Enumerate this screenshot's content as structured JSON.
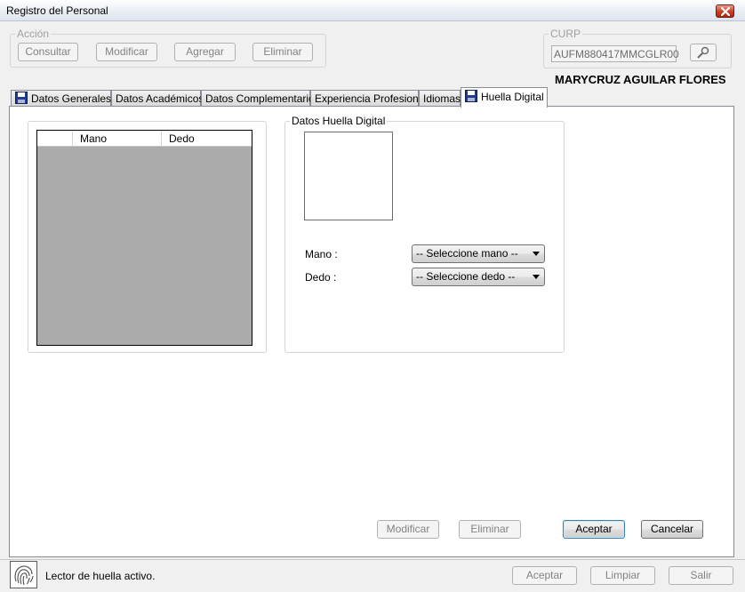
{
  "window": {
    "title": "Registro del Personal"
  },
  "accion": {
    "legend": "Acción",
    "buttons": [
      "Consultar",
      "Modificar",
      "Agregar",
      "Eliminar"
    ]
  },
  "curp": {
    "legend": "CURP",
    "value": "AUFM880417MMCGLR00"
  },
  "person": {
    "full_name": "MARYCRUZ AGUILAR FLORES"
  },
  "tabs": [
    {
      "label": "Datos Generales",
      "icon": "floppy-disk-icon"
    },
    {
      "label": "Datos Académicos"
    },
    {
      "label": "Datos Complementarios"
    },
    {
      "label": "Experiencia Profesional"
    },
    {
      "label": "Idiomas"
    },
    {
      "label": "Huella Digital",
      "icon": "floppy-disk-icon",
      "active": true
    }
  ],
  "grid": {
    "columns": [
      "",
      "Mano",
      "Dedo"
    ]
  },
  "huella": {
    "legend": "Datos Huella Digital",
    "mano_label": "Mano :",
    "dedo_label": "Dedo :",
    "mano_selected": "-- Seleccione mano --",
    "dedo_selected": "-- Seleccione dedo --"
  },
  "panel_buttons": {
    "modificar": "Modificar",
    "eliminar": "Eliminar",
    "aceptar": "Aceptar",
    "cancelar": "Cancelar"
  },
  "status": {
    "icon": "fingerprint-icon",
    "text": "Lector de huella activo.",
    "aceptar": "Aceptar",
    "limpiar": "Limpiar",
    "salir": "Salir"
  },
  "colors": {
    "grid_background": "#ababab",
    "close_button": "#c9462c"
  }
}
